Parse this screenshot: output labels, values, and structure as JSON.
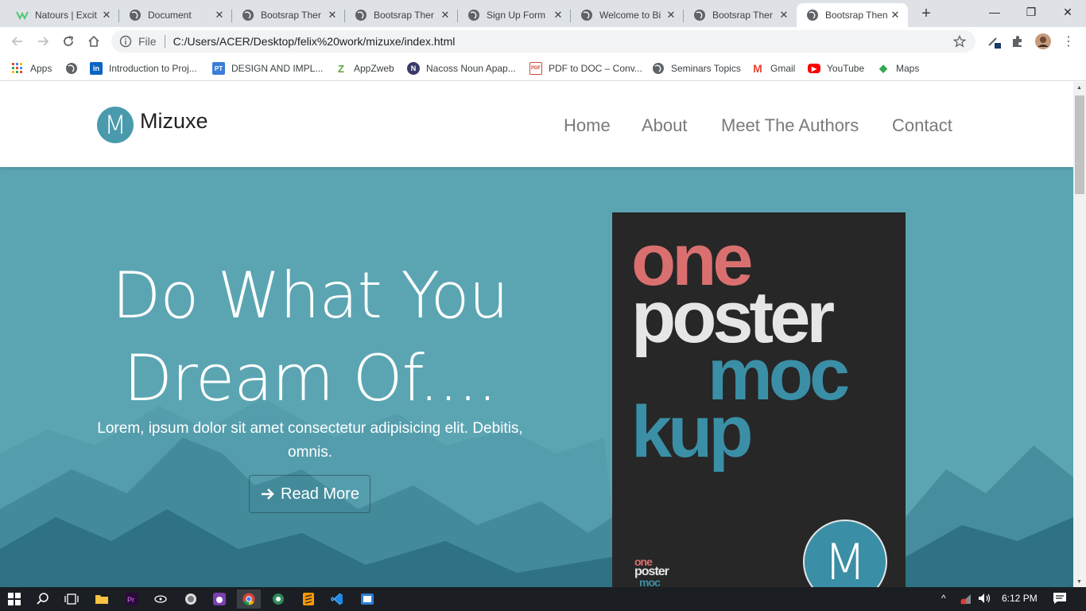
{
  "browser": {
    "tabs": [
      {
        "title": "Natours | Excit",
        "icon": "natours-icon"
      },
      {
        "title": "Document",
        "icon": "globe-icon"
      },
      {
        "title": "Bootsrap Ther",
        "icon": "globe-icon"
      },
      {
        "title": "Bootsrap Ther",
        "icon": "globe-icon"
      },
      {
        "title": "Sign Up Form",
        "icon": "globe-icon"
      },
      {
        "title": "Welcome to Bi",
        "icon": "globe-icon"
      },
      {
        "title": "Bootsrap Ther",
        "icon": "globe-icon"
      },
      {
        "title": "Bootsrap Then",
        "icon": "globe-icon",
        "active": true
      }
    ],
    "new_tab_label": "+",
    "window_controls": {
      "minimize": "—",
      "restore": "❐",
      "close": "✕"
    },
    "omnibox": {
      "scheme_label": "File",
      "url": "C:/Users/ACER/Desktop/felix%20work/mizuxe/index.html"
    },
    "bookmarks": [
      {
        "label": "Apps",
        "icon": "apps-grid-icon"
      },
      {
        "label": "",
        "icon": "globe-icon"
      },
      {
        "label": "Introduction to Proj...",
        "icon": "linkedin-icon",
        "glyph": "in",
        "color": "#0a66c2"
      },
      {
        "label": "DESIGN AND IMPL...",
        "icon": "pt-icon",
        "glyph": "PT",
        "color": "#3b7dd8"
      },
      {
        "label": "AppZweb",
        "icon": "appzweb-icon",
        "glyph": "Z",
        "color": "#5fa33a"
      },
      {
        "label": "Nacoss Noun Apap...",
        "icon": "nacoss-icon",
        "glyph": "N",
        "color": "#3a3a6a"
      },
      {
        "label": "PDF to DOC – Conv...",
        "icon": "pdf-icon",
        "glyph": "PDF",
        "color": "#c8503c"
      },
      {
        "label": "Seminars Topics",
        "icon": "globe-icon"
      },
      {
        "label": "Gmail",
        "icon": "gmail-icon",
        "glyph": "M",
        "color": "#ea4335"
      },
      {
        "label": "YouTube",
        "icon": "youtube-icon",
        "glyph": "▶",
        "color": "#ff0000"
      },
      {
        "label": "Maps",
        "icon": "maps-icon",
        "glyph": "◆",
        "color": "#34a853"
      }
    ]
  },
  "site": {
    "logo_letter": "M",
    "brand": "Mizuxe",
    "nav": [
      "Home",
      "About",
      "Meet The Authors",
      "Contact"
    ],
    "hero": {
      "heading_line1": "Do What You",
      "heading_line2": "Dream Of....",
      "lead": "Lorem, ipsum dolor sit amet consectetur adipisicing elit. Debitis, omnis.",
      "button_label": "Read More",
      "button_icon": "arrow-right-icon"
    },
    "poster": {
      "word1": "one",
      "word2": "poster",
      "word3": "moc",
      "word4": "kup",
      "small1": "one",
      "small2": "poster",
      "small3": "moc",
      "badge_letter": "M",
      "colors": {
        "one": "#d9706f",
        "poster": "#e6e6e6",
        "mockup": "#3a8fa6",
        "background": "#272727"
      }
    },
    "colors": {
      "hero": "#5ba5b3",
      "logo": "#4a9aad"
    }
  },
  "taskbar": {
    "apps": [
      "windows-start-icon",
      "search-icon",
      "task-view-icon",
      "file-explorer-icon",
      "premiere-icon",
      "cortana-icon",
      "app-icon",
      "app-icon",
      "chrome-icon",
      "app-icon",
      "sublime-icon",
      "vscode-icon",
      "app-icon"
    ],
    "clock": "6:12 PM",
    "tray_chevron": "^"
  }
}
